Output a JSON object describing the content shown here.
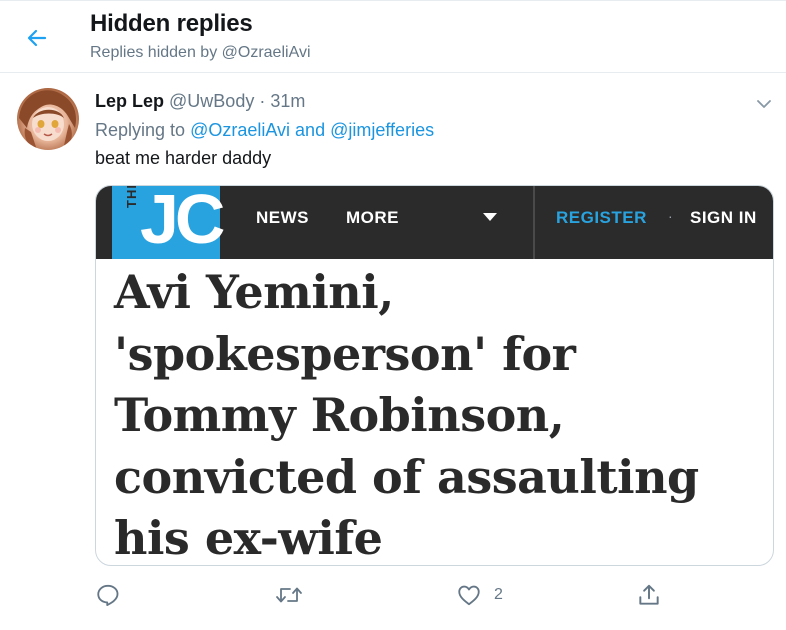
{
  "header": {
    "title": "Hidden replies",
    "subtitle": "Replies hidden by @OzraeliAvi",
    "back_icon": "arrow-left-icon"
  },
  "tweet": {
    "display_name": "Lep Lep",
    "handle": "@UwBody",
    "separator": "·",
    "time": "31m",
    "replying_prefix": "Replying to ",
    "replying_to": [
      "@OzraeliAvi",
      "@jimjefferies"
    ],
    "replying_joiner": "and",
    "text": "beat me harder daddy",
    "media": {
      "site_the": "THE",
      "site_logo": "JC",
      "nav": {
        "news": "NEWS",
        "more": "MORE",
        "register": "REGISTER",
        "separator": "·",
        "sign_in": "SIGN IN"
      },
      "headline_lines": [
        "Avi Yemini,",
        "'spokesperson' for",
        "Tommy Robinson,",
        "convicted of assaulting",
        "his ex-wife"
      ]
    },
    "actions": {
      "reply_icon": "reply-icon",
      "retweet_icon": "retweet-icon",
      "like_icon": "heart-icon",
      "like_count": "2",
      "share_icon": "share-icon"
    }
  },
  "colors": {
    "accent": "#1da1f2",
    "link": "#1b95e0",
    "secondary_text": "#657786",
    "jc_blue": "#29a3df",
    "jc_bar": "#2b2b2b"
  }
}
